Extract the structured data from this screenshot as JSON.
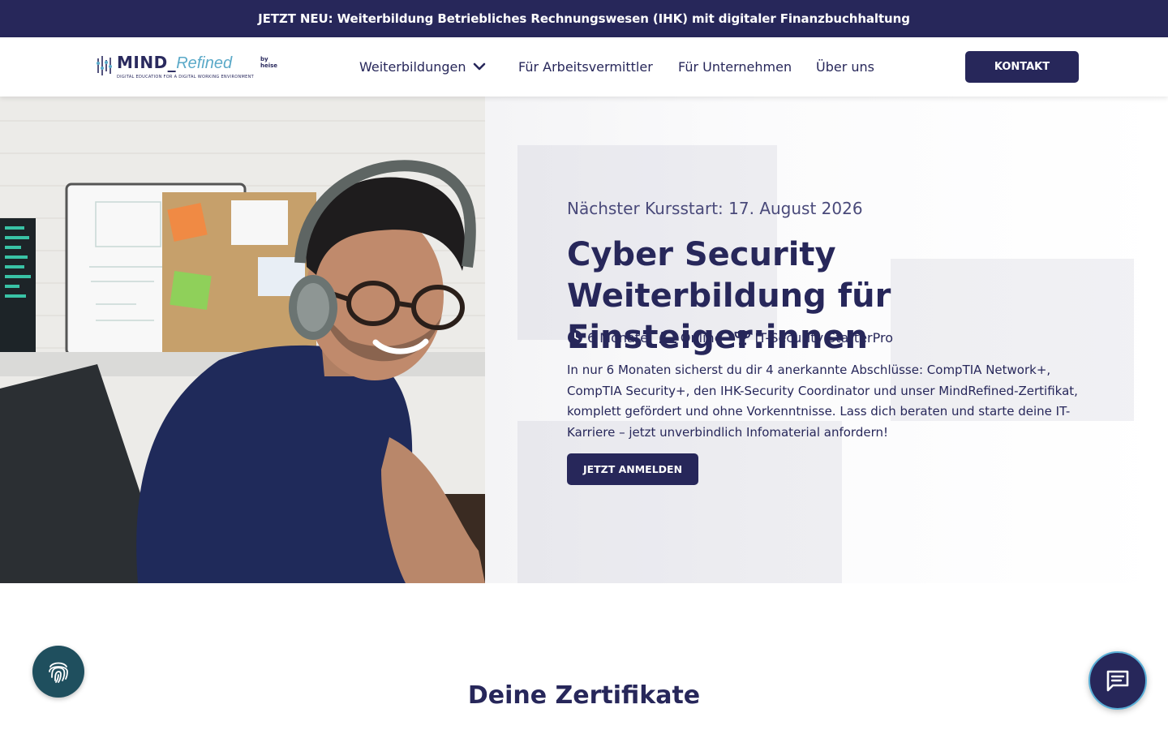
{
  "announcement": {
    "text": "JETZT NEU: Weiterbildung Betriebliches Rechnungswesen (IHK) mit digitaler Finanzbuchhaltung"
  },
  "header": {
    "logo": {
      "brand_main": "MIND_",
      "brand_accent": "Refined",
      "by": "by heise",
      "tagline": "DIGITAL EDUCATION FOR A DIGITAL WORKING ENVIRONMENT"
    },
    "nav": [
      {
        "label": "Weiterbildungen"
      },
      {
        "label": "Für Arbeitsvermittler"
      },
      {
        "label": "Für Unternehmen"
      },
      {
        "label": "Über uns"
      }
    ],
    "contact_label": "KONTAKT"
  },
  "hero": {
    "kursstart": "Nächster Kursstart: 17. August 2026",
    "title": "Cyber Security Weiterbildung für Einsteiger:innen",
    "meta": [
      {
        "icon": "clock-icon",
        "label": "6 Monate"
      },
      {
        "icon": "laptop-icon",
        "label": "Online"
      },
      {
        "icon": "trophy-icon",
        "label": "IT-Security StarterPro"
      }
    ],
    "description": "In nur 6 Monaten sicherst du dir 4 anerkannte Abschlüsse: CompTIA Network+, CompTIA Security+, den IHK-Security Coordinator und unser MindRefined-Zertifikat, komplett gefördert und ohne Vorkenntnisse. Lass dich beraten und starte deine IT-Karriere – jetzt unverbindlich Infomaterial anfordern!",
    "cta_label": "JETZT ANMELDEN"
  },
  "certificates": {
    "title": "Deine Zertifikate"
  },
  "widgets": {
    "fingerprint_icon": "fingerprint-icon",
    "chat_icon": "chat-icon"
  },
  "colors": {
    "brand_navy": "#27275a",
    "accent_blue": "#5aa9c8",
    "fingerprint_bg": "#1f4f5e"
  }
}
